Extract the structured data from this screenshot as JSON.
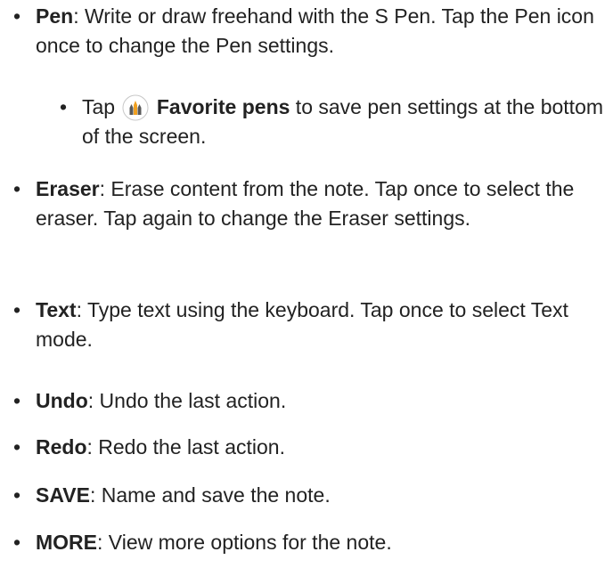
{
  "bullet_char": "•",
  "items": [
    {
      "term": "Pen",
      "desc": ": Write or draw freehand with the S Pen. Tap the Pen icon once to change the Pen settings."
    },
    {
      "pre": "Tap",
      "icon": "favorite-pens-icon",
      "term": "Favorite pens",
      "desc": " to save pen settings at the bottom of the screen."
    },
    {
      "term": "Eraser",
      "desc": ": Erase content from the note. Tap once to select the eraser. Tap again to change the Eraser settings."
    },
    {
      "term": "Text",
      "desc": ": Type text using the keyboard. Tap once to select Text mode."
    },
    {
      "term": "Undo",
      "desc": ": Undo the last action."
    },
    {
      "term": "Redo",
      "desc": ": Redo the last action."
    },
    {
      "term": "SAVE",
      "desc": ": Name and save the note."
    },
    {
      "term": "MORE",
      "desc": ": View more options for the note."
    }
  ]
}
